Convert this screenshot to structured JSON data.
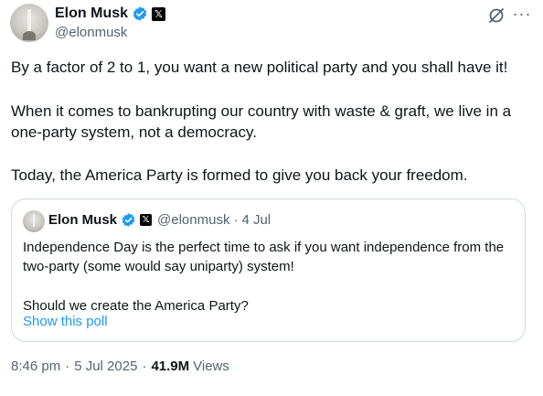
{
  "author": {
    "name": "Elon Musk",
    "handle": "@elonmusk",
    "verified_color": "#1d9bf0"
  },
  "tweet": {
    "paragraphs": [
      "By a factor of 2 to 1, you want a new political party and you shall have it!",
      "When it comes to bankrupting our country with waste & graft, we live in a one-party system, not a democracy.",
      "Today, the America Party is formed to give you back your freedom."
    ],
    "time": "8:46 pm",
    "date": "5 Jul 2025",
    "views_count": "41.9M",
    "views_label": "Views"
  },
  "quoted_tweet": {
    "name": "Elon Musk",
    "handle": "@elonmusk",
    "separator": "·",
    "date": "4 Jul",
    "text_line1": "Independence Day is the perfect time to ask if you want independence from the two-party (some would say uniparty) system!",
    "text_line2": "Should we create the America Party?",
    "poll_link": "Show this poll"
  },
  "icons": {
    "grok": "grok-icon",
    "more": "more-icon",
    "verified": "verified-badge-icon",
    "x_affiliate": "x-logo-icon"
  },
  "meta": {
    "separator": "·"
  }
}
